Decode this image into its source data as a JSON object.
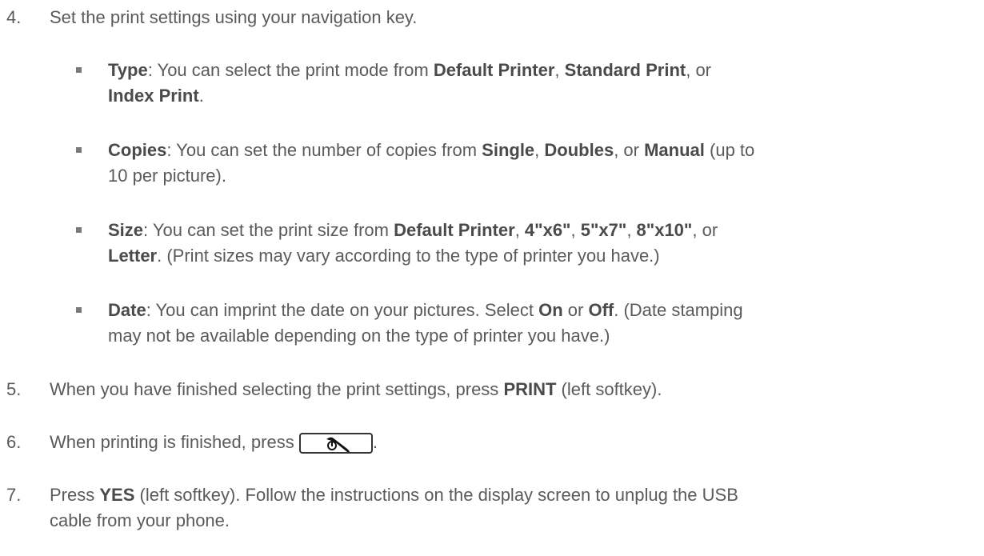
{
  "step4": {
    "number": "4.",
    "text": "Set the print settings using your navigation key."
  },
  "bullets": {
    "type": {
      "term": "Type",
      "t1": ": You can select the print mode from ",
      "o1": "Default Printer",
      "t2": ", ",
      "o2": "Standard Print",
      "t3": ", or",
      "o3": "Index Print",
      "t4": "."
    },
    "copies": {
      "term": "Copies",
      "t1": ": You can set the number of copies from ",
      "o1": "Single",
      "t2": ", ",
      "o2": "Doubles",
      "t3": ", or ",
      "o3": "Manual",
      "t4": " (up to",
      "t5": "10 per picture)."
    },
    "size": {
      "term": "Size",
      "t1": ": You can set the print size from ",
      "o1": "Default Printer",
      "t2": ", ",
      "o2": "4\"x6\"",
      "t3": ", ",
      "o3": "5\"x7\"",
      "t4": ", ",
      "o4": "8\"x10\"",
      "t5": ", or",
      "o5": "Letter",
      "t6": ". (Print sizes may vary according to the type of printer you have.)"
    },
    "date": {
      "term": "Date",
      "t1": ": You can imprint the date on your pictures. Select ",
      "o1": "On",
      "t2": " or ",
      "o2": "Off",
      "t3": ". (Date stamping",
      "t4": "may not be available depending on the type of printer you have.)"
    }
  },
  "step5": {
    "number": "5.",
    "t1": "When you have finished selecting the print settings, press ",
    "key": "PRINT",
    "t2": " (left softkey)."
  },
  "step6": {
    "number": "6.",
    "t1": "When printing is finished, press ",
    "icon": "end-power-key-icon",
    "t2": "."
  },
  "step7": {
    "number": "7.",
    "t1": "Press ",
    "key": "YES",
    "t2": " (left softkey). Follow the instructions on the display screen to unplug the USB",
    "t3": "cable from your phone."
  }
}
